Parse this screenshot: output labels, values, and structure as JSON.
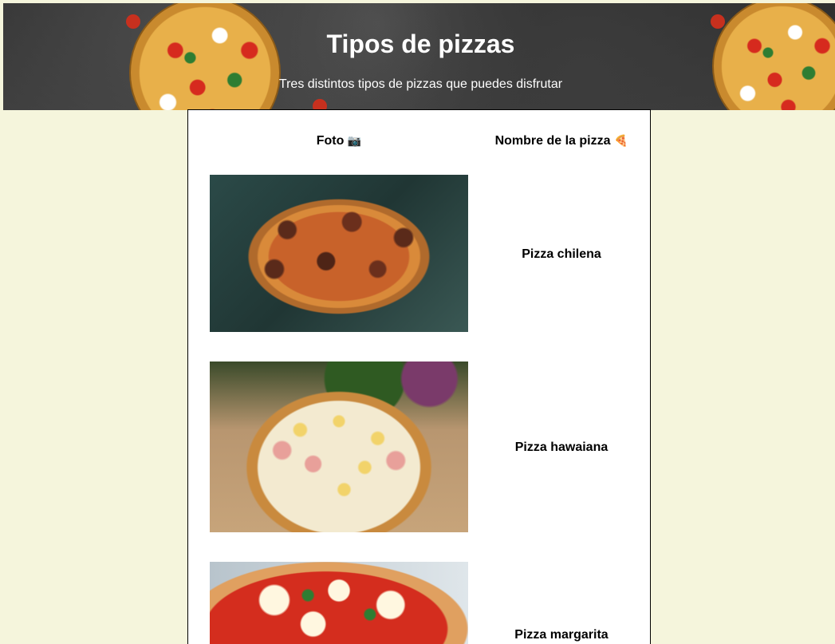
{
  "header": {
    "title": "Tipos de pizzas",
    "subtitle": "Tres distintos tipos de pizzas que puedes disfrutar"
  },
  "table": {
    "columns": [
      {
        "label": "Foto",
        "icon": "camera-icon",
        "glyph": "📷"
      },
      {
        "label": "Nombre de la pizza",
        "icon": "pizza-icon",
        "glyph": "🍕"
      }
    ],
    "rows": [
      {
        "name": "Pizza chilena",
        "photo": "pizza-chilena-photo"
      },
      {
        "name": "Pizza hawaiana",
        "photo": "pizza-hawaiana-photo"
      },
      {
        "name": "Pizza margarita",
        "photo": "pizza-margarita-photo"
      }
    ]
  },
  "colors": {
    "page_background": "#f5f5dc",
    "panel_background": "#ffffff",
    "header_text": "#ffffff"
  }
}
